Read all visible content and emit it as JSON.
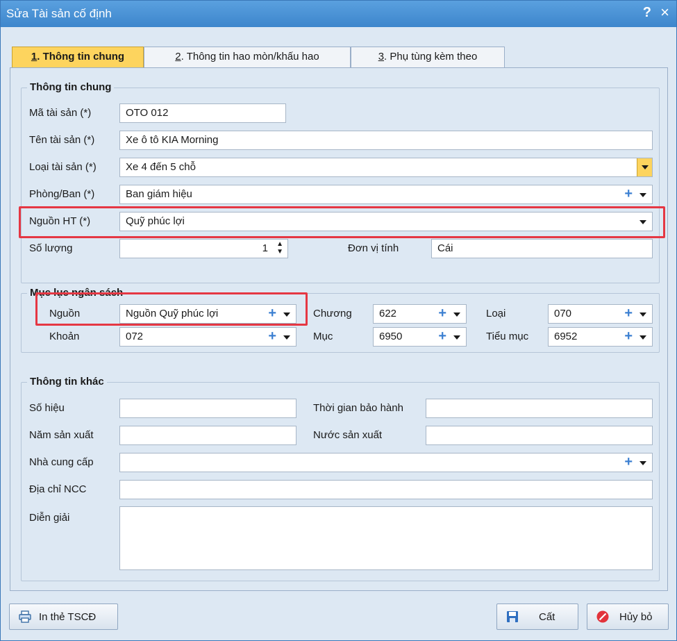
{
  "window": {
    "title": "Sửa Tài sản cố định",
    "help": "?",
    "close": "×"
  },
  "tabs": [
    {
      "num": "1",
      "label": ". Thông tin chung"
    },
    {
      "num": "2",
      "label": ". Thông tin hao mòn/khấu hao"
    },
    {
      "num": "3",
      "label": ". Phụ tùng kèm theo"
    }
  ],
  "general": {
    "title": "Thông tin chung",
    "asset_code_label": "Mã tài sản (*)",
    "asset_code": "OTO 012",
    "asset_name_label": "Tên tài sản (*)",
    "asset_name": "Xe ô tô KIA Morning",
    "asset_type_label": "Loại tài sản (*)",
    "asset_type": "Xe 4 đến 5 chỗ",
    "department_label": "Phòng/Ban (*)",
    "department": "Ban giám hiệu",
    "source_label": "Nguồn HT (*)",
    "source": "Quỹ phúc lợi",
    "quantity_label": "Số lượng",
    "quantity": "1",
    "unit_label": "Đơn vị tính",
    "unit": "Cái"
  },
  "budget": {
    "title": "Mục lục ngân sách",
    "source_label": "Nguồn",
    "source": "Nguồn Quỹ phúc lợi",
    "chapter_label": "Chương",
    "chapter": "622",
    "type_label": "Loại",
    "type": "070",
    "item_label": "Khoản",
    "item": "072",
    "section_label": "Mục",
    "section": "6950",
    "subsection_label": "Tiểu mục",
    "subsection": "6952"
  },
  "other": {
    "title": "Thông tin khác",
    "serial_label": "Số hiệu",
    "serial": "",
    "warranty_label": "Thời gian bảo hành",
    "warranty": "",
    "year_label": "Năm sản xuất",
    "year": "",
    "country_label": "Nước sản xuất",
    "country": "",
    "supplier_label": "Nhà cung cấp",
    "supplier": "",
    "supplier_address_label": "Địa chỉ NCC",
    "supplier_address": "",
    "description_label": "Diễn giải",
    "description": ""
  },
  "buttons": {
    "print": "In thẻ TSCĐ",
    "save": "Cất",
    "cancel": "Hủy bỏ"
  },
  "colors": {
    "titlebar": "#3d86cc",
    "active_tab": "#fdd45e",
    "highlight": "#e53743",
    "plus": "#3b7fd1"
  }
}
